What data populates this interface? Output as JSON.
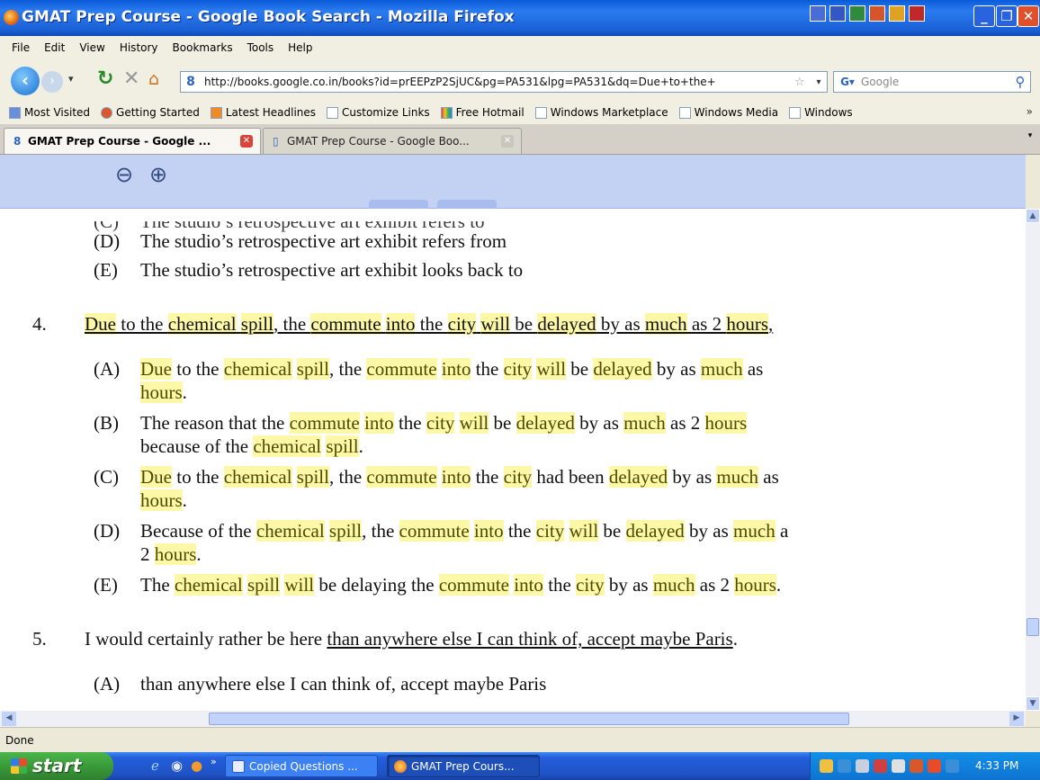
{
  "window": {
    "title": "GMAT Prep Course - Google Book Search - Mozilla Firefox"
  },
  "menu": [
    "File",
    "Edit",
    "View",
    "History",
    "Bookmarks",
    "Tools",
    "Help"
  ],
  "navbar": {
    "url": "http://books.google.co.in/books?id=prEEPzP2SjUC&pg=PA531&lpg=PA531&dq=Due+to+the+",
    "search_placeholder": "Google"
  },
  "bookmarks": [
    "Most Visited",
    "Getting Started",
    "Latest Headlines",
    "Customize Links",
    "Free Hotmail",
    "Windows Marketplace",
    "Windows Media",
    "Windows"
  ],
  "tabs": [
    {
      "label": "GMAT Prep Course - Google ..."
    },
    {
      "label": "GMAT Prep Course - Google Boo..."
    }
  ],
  "book": {
    "top_cut_line": "The studio’s retrospective art exhibit refers to",
    "top_cut_label": "(C)",
    "q3": {
      "d_label": "(D)",
      "d_text": "The studio’s retrospective art exhibit refers from",
      "e_label": "(E)",
      "e_text": "The studio’s retrospective art exhibit looks back to"
    },
    "q4_num": "4.",
    "q5_num": "5.",
    "q5_stem_plain": "I would certainly rather be here ",
    "q5_stem_underlined": "than anywhere else I can think of, accept maybe Paris",
    "q5_stem_end": ".",
    "q5_a_label": "(A)",
    "q5_a_text": "than anywhere else I can think of, accept maybe Paris",
    "labels": {
      "a": "(A)",
      "b": "(B)",
      "c": "(C)",
      "d": "(D)",
      "e": "(E)"
    },
    "words": {
      "due": "Due",
      "to_the": " to the ",
      "chemical": "chemical",
      "spill": "spill",
      "comma_the": ", the ",
      "commute": "commute",
      "into": "into",
      "the": " the ",
      "city": "city",
      "will": "will",
      "be": " be ",
      "delayed": "delayed",
      "by_as": " by as ",
      "much": "much",
      "as_2": " as 2 ",
      "hours": "hours",
      "period": ".",
      "comma_period": ",",
      "as": " as",
      "reason_prefix": "The reason that the ",
      "because_of_the": "because of the ",
      "had_been": " had been ",
      "because_prefix": "Because of the ",
      "two": "2 ",
      "the_prefix": "The ",
      "be_delaying": " be delaying the ",
      "by_as_2": " by as ",
      "as_2b": " as 2 ",
      "cut_a": " a",
      "space": " "
    }
  },
  "status": "Done",
  "taskbar": {
    "start": "start",
    "task1": "Copied Questions ...",
    "task2": "GMAT Prep Cours...",
    "clock": "4:33 PM"
  },
  "colors": {
    "highlight": "#fdf8a8",
    "titlebar": "#1a5fd4",
    "start_button": "#3a9b39"
  }
}
